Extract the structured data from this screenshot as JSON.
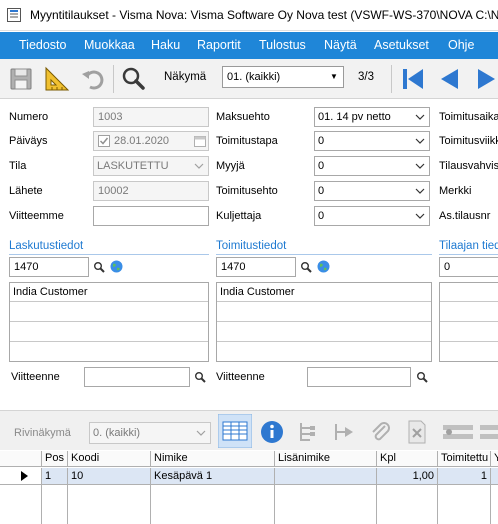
{
  "window": {
    "title": "Myyntitilaukset - Visma Nova: Visma Software Oy Nova test (VSWF-WS-370\\NOVA C:\\NO"
  },
  "menu": [
    "Tiedosto",
    "Muokkaa",
    "Haku",
    "Raportit",
    "Tulostus",
    "Näytä",
    "Asetukset",
    "Ohje"
  ],
  "toolbar": {
    "view_label": "Näkymä",
    "view_value": "01. (kaikki)",
    "record_counter": "3/3",
    "icons": [
      "save-icon",
      "ruler-triangle-icon",
      "undo-icon",
      "search-icon",
      "first-record-icon",
      "previous-record-icon",
      "next-record-icon"
    ]
  },
  "form": {
    "col1": {
      "numero_label": "Numero",
      "numero_value": "1003",
      "paivays_label": "Päiväys",
      "paivays_value": "28.01.2020",
      "tila_label": "Tila",
      "tila_value": "LASKUTETTU",
      "lahete_label": "Lähete",
      "lahete_value": "10002",
      "viitteemme_label": "Viitteemme",
      "viitteemme_value": ""
    },
    "col2": {
      "maksuehto_label": "Maksuehto",
      "maksuehto_value": "01. 14 pv netto",
      "toimitustapa_label": "Toimitustapa",
      "toimitustapa_value": "0",
      "myyja_label": "Myyjä",
      "myyja_value": "0",
      "toimitusehto_label": "Toimitusehto",
      "toimitusehto_value": "0",
      "kuljettaja_label": "Kuljettaja",
      "kuljettaja_value": "0"
    },
    "col3": {
      "toimitusaika_label": "Toimitusaika",
      "toimitusviikko_label": "Toimitusviikk",
      "tilausvahvistus_label": "Tilausvahvist",
      "merkki_label": "Merkki",
      "astilausnr_label": "As.tilausnr"
    }
  },
  "billing": {
    "title": "Laskutustiedot",
    "customer_no": "1470",
    "address_line1": "India Customer",
    "viitteenne_label": "Viitteenne",
    "viitteenne_value": ""
  },
  "delivery": {
    "title": "Toimitustiedot",
    "customer_no": "1470",
    "address_line1": "India Customer",
    "viitteenne_label": "Viitteenne",
    "viitteenne_value": ""
  },
  "orderer": {
    "title": "Tilaajan tiedo",
    "customer_no": "0"
  },
  "rows_toolbar": {
    "view_label": "Rivinäkymä",
    "view_value": "0. (kaikki)"
  },
  "grid": {
    "columns": [
      "Pos",
      "Koodi",
      "Nimike",
      "Lisänimike",
      "Kpl",
      "Toimitettu",
      "Y"
    ],
    "rows": [
      {
        "pos": "1",
        "koodi": "10",
        "nimike": "Kesäpävä 1",
        "lisanimike": "",
        "kpl": "1,00",
        "toimitettu": "1",
        "y": ""
      }
    ]
  },
  "colors": {
    "menubar": "#1f86d8",
    "link": "#1f7ad1",
    "nav_arrow": "#2e78d0",
    "selected_row": "#dce6f4"
  }
}
